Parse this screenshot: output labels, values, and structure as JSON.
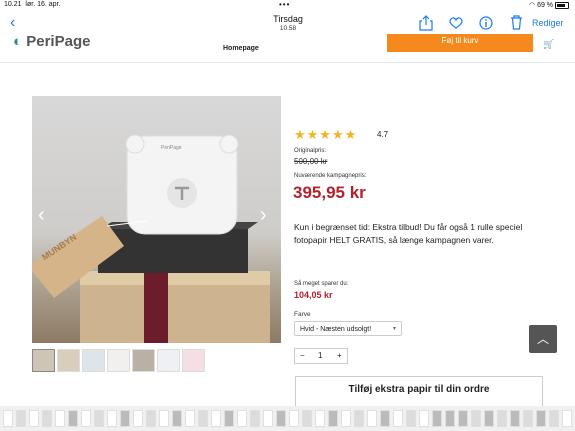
{
  "status_bar": {
    "time": "10.21",
    "date": "lør. 16. apr.",
    "dots": "•••",
    "battery": "69 %"
  },
  "nav": {
    "title": "Tirsdag",
    "subtitle": "10.58",
    "edit_label": "Rediger",
    "icons": [
      "back-chevron",
      "share-icon",
      "heart-icon",
      "info-icon",
      "trash-icon"
    ]
  },
  "site": {
    "logo_prefix": "Peri",
    "logo_suffix": "Page",
    "breadcrumb": "Homepage",
    "add_to_cart_label": "Føj til kurv",
    "cart_icon": "cart-icon"
  },
  "product": {
    "image_brand_printer": "PeriPage",
    "image_brand_tag": "MUNBYN",
    "rating_stars": "★★★★★",
    "rating_value": "4.7",
    "original_price_label": "Originalpris:",
    "original_price": "500,00 kr",
    "current_price_label": "Nuværende kampagnepris:",
    "current_price": "395,95 kr",
    "description": "Kun i begrænset tid: Ekstra tilbud! Du får også 1 rulle speciel fotopapir HELT GRATIS, så længe kampagnen varer.",
    "savings_label": "Så meget sparer du:",
    "savings_value": "104,05 kr",
    "color_label": "Farve",
    "color_selected": "Hvid - Næsten udsolgt!",
    "quantity_minus": "−",
    "quantity_value": "1",
    "quantity_plus": "+",
    "extra_paper_heading": "Tilføj ekstra papir til din ordre"
  },
  "accent_colors": {
    "brand": "#2d8d8c",
    "cta": "#f5891d",
    "price": "#b5202c",
    "stars": "#f0b525",
    "ios_blue": "#1a7bf6"
  }
}
